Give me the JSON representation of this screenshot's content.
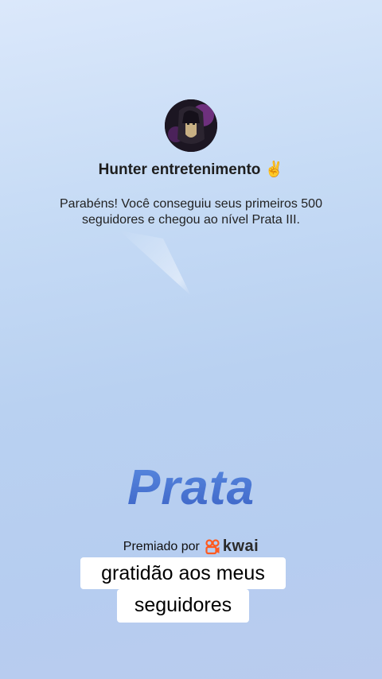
{
  "profile": {
    "name": "Hunter entretenimento ✌️",
    "message": "Parabéns! Você conseguiu seus primeiros 500 seguidores e chegou ao nível Prata III."
  },
  "badge": {
    "tier": "Prata"
  },
  "sponsor": {
    "label": "Premiado por",
    "brand": "kwai",
    "brand_color": "#ff5a1f"
  },
  "caption": {
    "line1": "gratidão aos meus",
    "line2": "seguidores"
  },
  "colors": {
    "tier_accent": "#4170cf"
  }
}
